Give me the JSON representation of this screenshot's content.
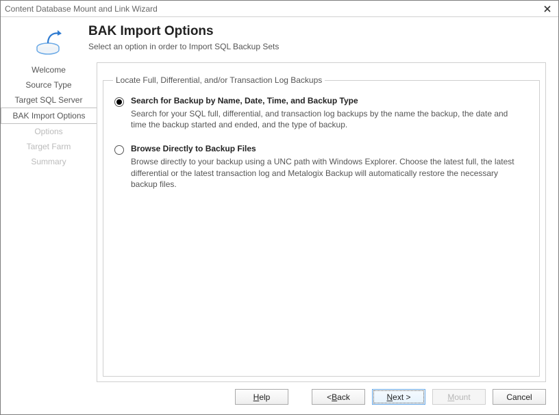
{
  "window": {
    "title": "Content Database Mount and Link Wizard"
  },
  "header": {
    "title": "BAK Import Options",
    "subtitle": "Select an option in order to Import SQL Backup Sets"
  },
  "sidebar": {
    "steps": [
      {
        "label": "Welcome",
        "state": "normal"
      },
      {
        "label": "Source Type",
        "state": "normal"
      },
      {
        "label": "Target SQL Server",
        "state": "normal"
      },
      {
        "label": "BAK Import Options",
        "state": "active"
      },
      {
        "label": "Options",
        "state": "disabled"
      },
      {
        "label": "Target Farm",
        "state": "disabled"
      },
      {
        "label": "Summary",
        "state": "disabled"
      }
    ]
  },
  "content": {
    "group_legend": "Locate Full, Differential, and/or Transaction Log Backups",
    "options": [
      {
        "selected": true,
        "title": "Search for Backup by Name, Date, Time, and Backup Type",
        "description": "Search for your SQL full, differential, and transaction log backups by the name the backup, the date and time the backup started and ended, and the type of backup."
      },
      {
        "selected": false,
        "title": "Browse Directly to Backup Files",
        "description": "Browse directly to your backup using a UNC path with Windows Explorer. Choose the latest full, the latest differential or the latest transaction log and Metalogix Backup will automatically restore the necessary backup files."
      }
    ]
  },
  "footer": {
    "help_u": "H",
    "help_rest": "elp",
    "back_prefix": "< ",
    "back_u": "B",
    "back_rest": "ack",
    "next_u": "N",
    "next_rest": "ext >",
    "mount_u": "M",
    "mount_rest": "ount",
    "cancel": "Cancel"
  }
}
